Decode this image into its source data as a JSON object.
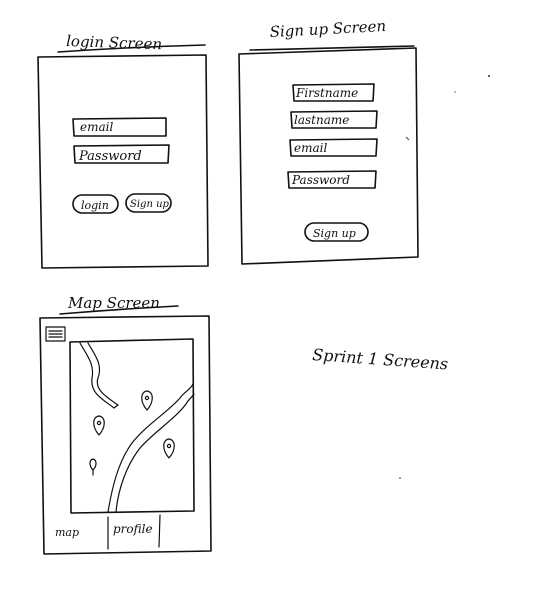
{
  "login_screen": {
    "title": "login Screen",
    "email_field": "email",
    "password_field": "Password",
    "login_button": "login",
    "signup_button": "Sign up"
  },
  "signup_screen": {
    "title": "Sign up Screen",
    "firstname_field": "Firstname",
    "lastname_field": "lastname",
    "email_field": "email",
    "password_field": "Password",
    "signup_button": "Sign up"
  },
  "map_screen": {
    "title": "Map Screen",
    "menu_icon": "hamburger-menu-icon",
    "pin_icon": "map-pin-icon",
    "nav_map": "map",
    "nav_profile": "profile"
  },
  "caption": "Sprint 1 Screens"
}
